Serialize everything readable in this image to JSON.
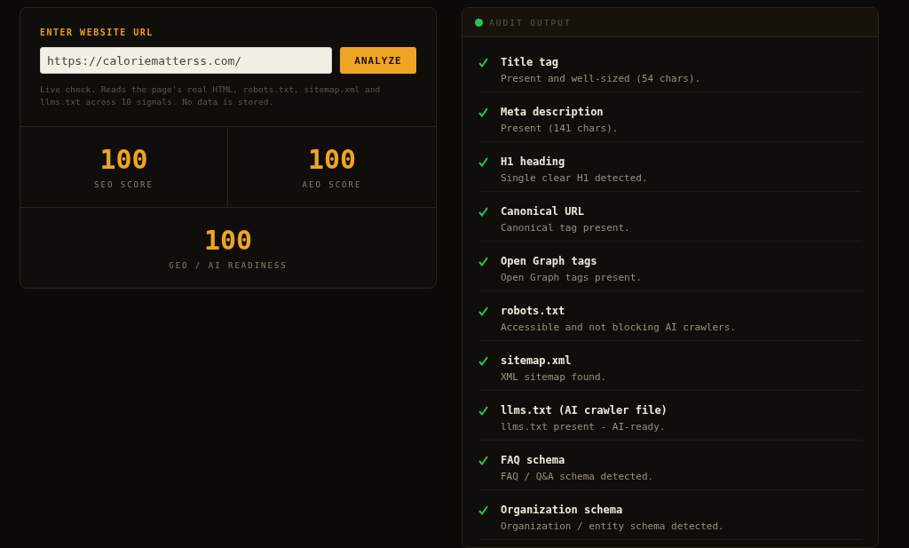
{
  "url_form": {
    "label": "ENTER WEBSITE URL",
    "url": "https://caloriematterss.com/",
    "button": "ANALYZE",
    "note": "Live check. Reads the page's real HTML, robots.txt, sitemap.xml and llms.txt across 10 signals. No data is stored."
  },
  "scores": [
    {
      "value": "100",
      "label": "SEO SCORE"
    },
    {
      "value": "100",
      "label": "AEO SCORE"
    },
    {
      "value": "100",
      "label": "GEO / AI READINESS"
    }
  ],
  "audit": {
    "title": "AUDIT OUTPUT",
    "checks": [
      {
        "name": "Title tag",
        "detail": "Present and well-sized (54 chars).",
        "passed": true
      },
      {
        "name": "Meta description",
        "detail": "Present (141 chars).",
        "passed": true
      },
      {
        "name": "H1 heading",
        "detail": "Single clear H1 detected.",
        "passed": true
      },
      {
        "name": "Canonical URL",
        "detail": "Canonical tag present.",
        "passed": true
      },
      {
        "name": "Open Graph tags",
        "detail": "Open Graph tags present.",
        "passed": true
      },
      {
        "name": "robots.txt",
        "detail": "Accessible and not blocking AI crawlers.",
        "passed": true
      },
      {
        "name": "sitemap.xml",
        "detail": "XML sitemap found.",
        "passed": true
      },
      {
        "name": "llms.txt (AI crawler file)",
        "detail": "llms.txt present - AI-ready.",
        "passed": true
      },
      {
        "name": "FAQ schema",
        "detail": "FAQ / Q&A schema detected.",
        "passed": true
      },
      {
        "name": "Organization schema",
        "detail": "Organization / entity schema detected.",
        "passed": true
      }
    ]
  }
}
